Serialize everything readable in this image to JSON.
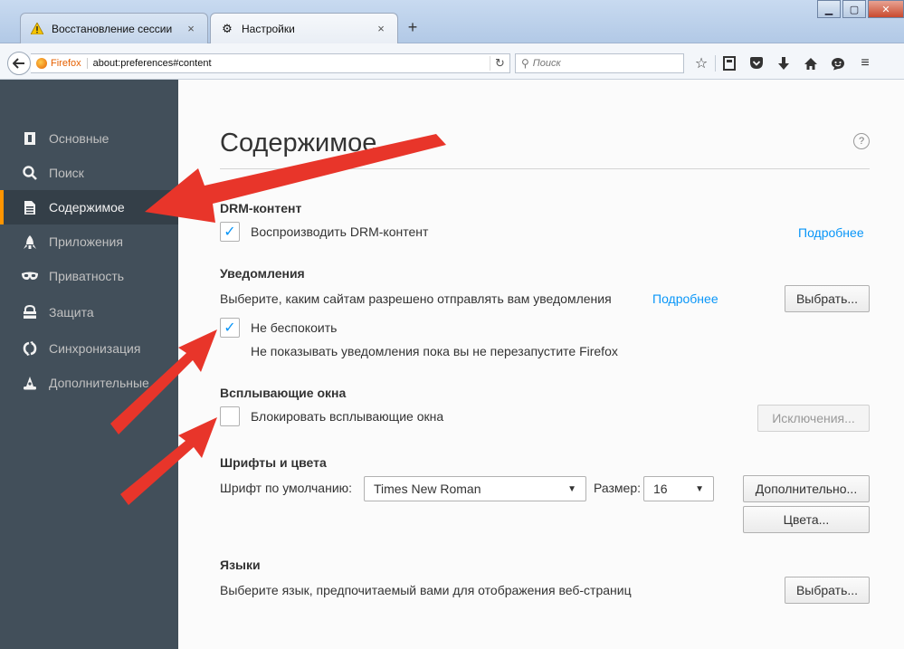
{
  "tabs": [
    {
      "label": "Восстановление сессии",
      "icon": "warning-icon",
      "active": false
    },
    {
      "label": "Настройки",
      "icon": "gear-icon",
      "active": true
    }
  ],
  "navbar": {
    "identity_label": "Firefox",
    "url": "about:preferences#content",
    "search_placeholder": "Поиск"
  },
  "sidebar": {
    "items": [
      {
        "label": "Основные",
        "icon": "general-icon"
      },
      {
        "label": "Поиск",
        "icon": "search-icon"
      },
      {
        "label": "Содержимое",
        "icon": "content-document-icon",
        "selected": true
      },
      {
        "label": "Приложения",
        "icon": "rocket-icon"
      },
      {
        "label": "Приватность",
        "icon": "mask-icon"
      },
      {
        "label": "Защита",
        "icon": "lock-icon"
      },
      {
        "label": "Синхронизация",
        "icon": "sync-icon"
      },
      {
        "label": "Дополнительные",
        "icon": "wizard-hat-icon"
      }
    ]
  },
  "content": {
    "title": "Содержимое",
    "help": "?",
    "drm": {
      "heading": "DRM-контент",
      "checkbox_label": "Воспроизводить DRM-контент",
      "checked": true,
      "learn_more": "Подробнее"
    },
    "notifications": {
      "heading": "Уведомления",
      "description": "Выберите, каким сайтам разрешено отправлять вам уведомления",
      "learn_more": "Подробнее",
      "choose_button": "Выбрать...",
      "dnd_label": "Не беспокоить",
      "dnd_checked": true,
      "dnd_note": "Не показывать уведомления пока вы не перезапустите Firefox"
    },
    "popups": {
      "heading": "Всплывающие окна",
      "checkbox_label": "Блокировать всплывающие окна",
      "checked": false,
      "exceptions_button": "Исключения..."
    },
    "fonts": {
      "heading": "Шрифты и цвета",
      "default_font_label": "Шрифт по умолчанию:",
      "default_font_value": "Times New Roman",
      "size_label": "Размер:",
      "size_value": "16",
      "advanced_button": "Дополнительно...",
      "colors_button": "Цвета..."
    },
    "languages": {
      "heading": "Языки",
      "description": "Выберите язык, предпочитаемый вами для отображения веб-страниц",
      "choose_button": "Выбрать..."
    }
  },
  "colors": {
    "annotation_arrow": "#e8352a",
    "sidebar_bg": "#424f5a",
    "accent_link": "#0996f8",
    "selected_marker": "#ff9500"
  }
}
